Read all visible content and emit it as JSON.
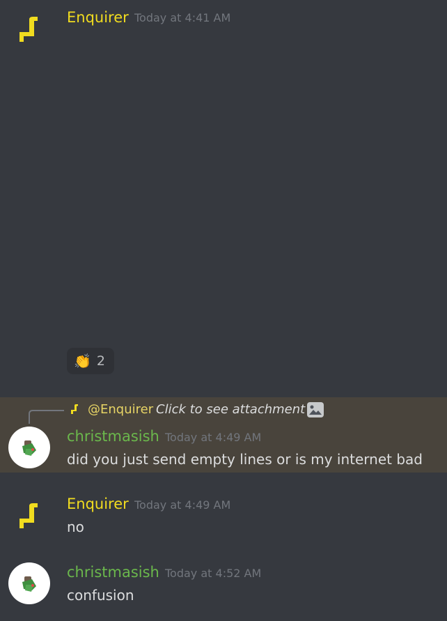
{
  "messages": [
    {
      "username": "Enquirer",
      "timestamp": "Today at 4:41 AM",
      "reaction": {
        "emoji": "👏",
        "count": "2"
      }
    },
    {
      "reply": {
        "mention": "@Enquirer",
        "text": "Click to see attachment"
      },
      "username": "christmasish",
      "timestamp": "Today at 4:49 AM",
      "text": "did you just send empty lines or is my internet bad"
    },
    {
      "username": "Enquirer",
      "timestamp": "Today at 4:49 AM",
      "text": "no"
    },
    {
      "username": "christmasish",
      "timestamp": "Today at 4:52 AM",
      "text": "confusion"
    }
  ],
  "colors": {
    "background": "#36393f",
    "highlight": "#49443c",
    "enquirer_name": "#f1dc1f",
    "christmasish_name": "#6bb84c",
    "timestamp": "#72767d",
    "text": "#dcddde"
  },
  "icons": {
    "enquirer_avatar": "yellow-hook-icon",
    "christmasish_avatar": "tree-character-icon",
    "attachment": "image-icon"
  }
}
